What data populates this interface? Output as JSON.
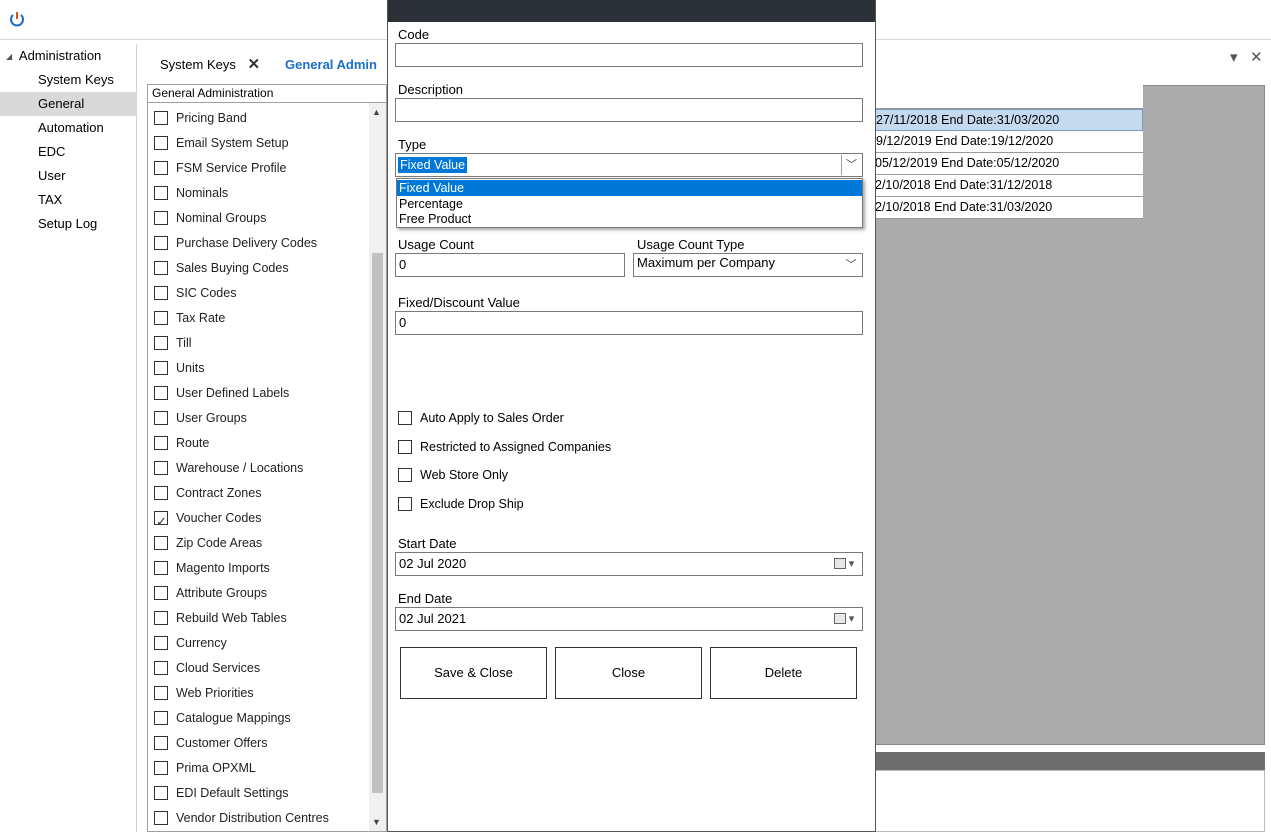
{
  "nav": {
    "root": "Administration",
    "items": [
      "System Keys",
      "General",
      "Automation",
      "EDC",
      "User",
      "TAX",
      "Setup Log"
    ],
    "selected_index": 1
  },
  "tabs": {
    "items": [
      {
        "label": "System Keys",
        "close": "✕"
      },
      {
        "label": "General Admin"
      }
    ],
    "pin_icon": "▾",
    "close_icon": "✕"
  },
  "list": {
    "header": "General Administration",
    "items": [
      {
        "label": "Pricing Band",
        "checked": false
      },
      {
        "label": "Email System Setup",
        "checked": false
      },
      {
        "label": "FSM Service Profile",
        "checked": false
      },
      {
        "label": "Nominals",
        "checked": false
      },
      {
        "label": "Nominal Groups",
        "checked": false
      },
      {
        "label": "Purchase Delivery Codes",
        "checked": false
      },
      {
        "label": "Sales Buying Codes",
        "checked": false
      },
      {
        "label": "SIC Codes",
        "checked": false
      },
      {
        "label": "Tax Rate",
        "checked": false
      },
      {
        "label": "Till",
        "checked": false
      },
      {
        "label": "Units",
        "checked": false
      },
      {
        "label": "User Defined Labels",
        "checked": false
      },
      {
        "label": "User Groups",
        "checked": false
      },
      {
        "label": "Route",
        "checked": false
      },
      {
        "label": "Warehouse / Locations",
        "checked": false
      },
      {
        "label": "Contract Zones",
        "checked": false
      },
      {
        "label": "Voucher Codes",
        "checked": true
      },
      {
        "label": "Zip Code Areas",
        "checked": false
      },
      {
        "label": "Magento Imports",
        "checked": false
      },
      {
        "label": "Attribute Groups",
        "checked": false
      },
      {
        "label": "Rebuild Web Tables",
        "checked": false
      },
      {
        "label": "Currency",
        "checked": false
      },
      {
        "label": "Cloud Services",
        "checked": false
      },
      {
        "label": "Web Priorities",
        "checked": false
      },
      {
        "label": "Catalogue Mappings",
        "checked": false
      },
      {
        "label": "Customer Offers",
        "checked": false
      },
      {
        "label": "Prima OPXML",
        "checked": false
      },
      {
        "label": "EDI Default Settings",
        "checked": false
      },
      {
        "label": "Vendor Distribution Centres",
        "checked": false
      }
    ]
  },
  "grid": {
    "rows": [
      {
        "text": "27/11/2018 End Date:31/03/2020",
        "selected": true
      },
      {
        "text": "9/12/2019 End Date:19/12/2020",
        "selected": false
      },
      {
        "text": "05/12/2019 End Date:05/12/2020",
        "selected": false
      },
      {
        "text": "2/10/2018 End Date:31/12/2018",
        "selected": false
      },
      {
        "text": "2/10/2018 End Date:31/03/2020",
        "selected": false
      }
    ]
  },
  "dialog": {
    "code_label": "Code",
    "code_value": "",
    "description_label": "Description",
    "description_value": "",
    "type_label": "Type",
    "type_value": "Fixed Value",
    "type_options": [
      "Fixed Value",
      "Percentage",
      "Free Product"
    ],
    "usage_count_label": "Usage Count",
    "usage_count_value": "0",
    "usage_count_type_label": "Usage Count Type",
    "usage_count_type_value": "Maximum per Company",
    "fixed_discount_label": "Fixed/Discount Value",
    "fixed_discount_value": "0",
    "checkboxes": [
      {
        "label": "Auto Apply to Sales Order",
        "checked": false
      },
      {
        "label": "Restricted to Assigned Companies",
        "checked": false
      },
      {
        "label": "Web Store Only",
        "checked": false
      },
      {
        "label": "Exclude Drop Ship",
        "checked": false
      }
    ],
    "start_date_label": "Start Date",
    "start_date_value": "02 Jul 2020",
    "end_date_label": "End Date",
    "end_date_value": "02 Jul 2021",
    "buttons": {
      "save_close": "Save & Close",
      "close": "Close",
      "delete": "Delete"
    }
  }
}
